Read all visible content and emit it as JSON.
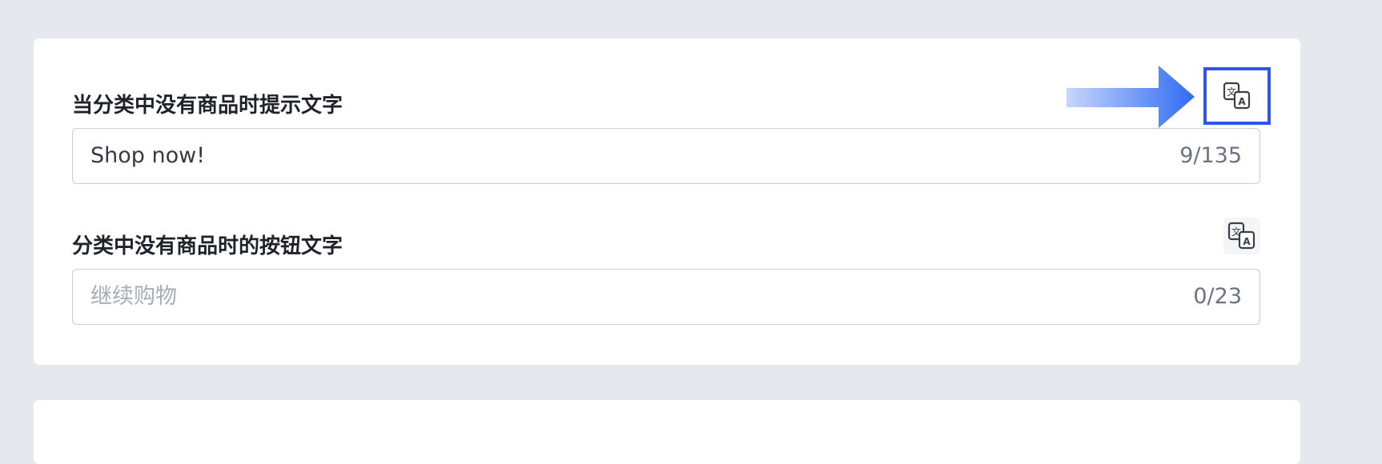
{
  "fields": [
    {
      "label": "当分类中没有商品时提示文字",
      "value": "Shop now!",
      "counter": "9/135",
      "translate_icon": "translate-icon"
    },
    {
      "label": "分类中没有商品时的按钮文字",
      "placeholder": "继续购物",
      "counter": "0/23",
      "translate_icon": "translate-icon"
    }
  ],
  "colors": {
    "page_background": "#e5e8ed",
    "card_background": "#ffffff",
    "highlight": "#2f55f0",
    "input_border": "#c9cdd9",
    "placeholder": "#a5acba"
  }
}
